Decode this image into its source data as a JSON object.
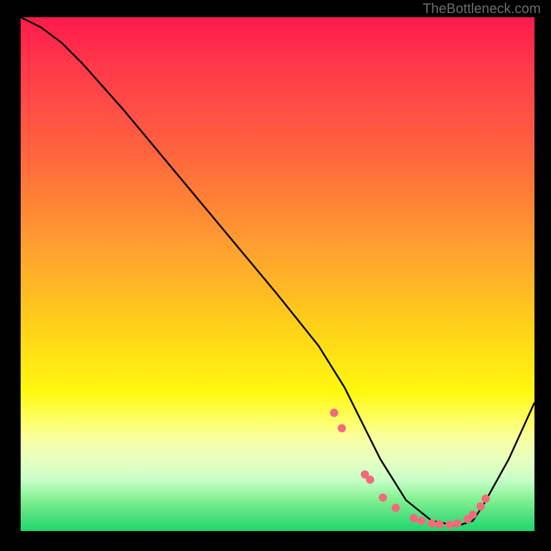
{
  "attribution": "TheBottleneck.com",
  "chart_data": {
    "type": "line",
    "title": "",
    "xlabel": "",
    "ylabel": "",
    "xlim": [
      0,
      100
    ],
    "ylim": [
      0,
      100
    ],
    "series": [
      {
        "name": "curve",
        "x": [
          0,
          4,
          8,
          12,
          20,
          30,
          40,
          50,
          58,
          63,
          66,
          70,
          75,
          80,
          85,
          88,
          90,
          95,
          100
        ],
        "y": [
          100,
          98,
          95,
          91,
          82,
          70,
          58,
          46,
          36,
          28,
          22,
          14,
          6,
          2,
          1,
          2,
          5,
          14,
          25
        ]
      }
    ],
    "markers": {
      "name": "highlight-points",
      "color": "#f36b7a",
      "x": [
        61,
        62.5,
        67,
        68,
        70.5,
        73,
        76.5,
        78,
        80,
        81.5,
        83.5,
        85,
        87,
        88,
        89.5,
        90.5
      ],
      "y": [
        23,
        20,
        11,
        10,
        6.5,
        4.5,
        2.5,
        2,
        1.5,
        1.3,
        1.2,
        1.5,
        2.3,
        3.2,
        4.8,
        6.3
      ]
    },
    "gradient_stops": [
      {
        "pos": 0,
        "color": "#ff1a4a"
      },
      {
        "pos": 25,
        "color": "#ff6040"
      },
      {
        "pos": 55,
        "color": "#ffc020"
      },
      {
        "pos": 78,
        "color": "#ffff60"
      },
      {
        "pos": 100,
        "color": "#1cd86c"
      }
    ]
  }
}
